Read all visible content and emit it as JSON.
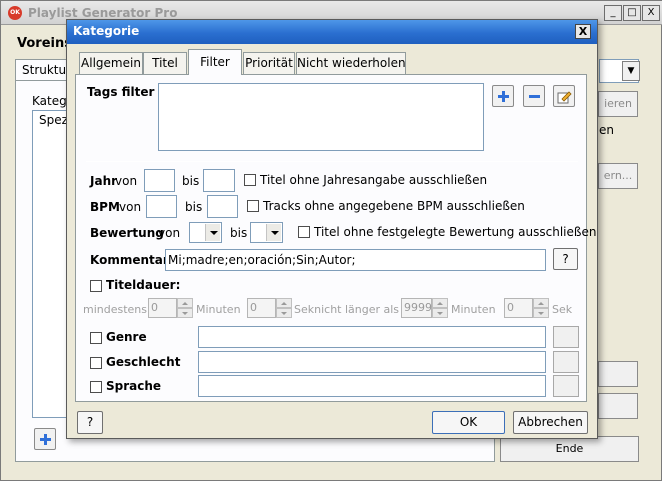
{
  "main_window": {
    "title": "Playlist Generator Pro",
    "app_icon_text": "OK",
    "minimize_glyph": "_",
    "maximize_glyph": "□",
    "close_glyph": "X",
    "voreinst_label": "Voreinst",
    "struktur_tab": "Struktur",
    "kategorie_label": "Katego",
    "list_item": "Spezi",
    "right_btn_1": "ieren",
    "right_label_2": "en",
    "right_btn_3": "ern...",
    "ende_button": "Ende",
    "dropdown_arrow": "▼"
  },
  "dialog": {
    "title": "Kategorie",
    "close_glyph": "X",
    "tabs": [
      {
        "label": "Allgemein"
      },
      {
        "label": "Titel"
      },
      {
        "label": "Filter"
      },
      {
        "label": "Priorität"
      },
      {
        "label": "Nicht wiederholen"
      }
    ],
    "active_tab": "Filter",
    "filter": {
      "tags_label": "Tags filter",
      "tags_value": "",
      "jahr": {
        "label": "Jahr",
        "von": "von",
        "bis": "bis",
        "from_value": "",
        "to_value": "",
        "exclude_label": "Titel ohne Jahresangabe ausschließen"
      },
      "bpm": {
        "label": "BPM",
        "von": "von",
        "bis": "bis",
        "from_value": "",
        "to_value": "",
        "exclude_label": "Tracks ohne angegebene BPM ausschließen"
      },
      "bewertung": {
        "label": "Bewertung",
        "von": "von",
        "bis": "bis",
        "exclude_label": "Titel ohne festgelegte Bewertung ausschließen"
      },
      "kommentar": {
        "label": "Kommentar:",
        "value": "Mi;madre;en;oración;Sin;Autor;",
        "help_button": "?"
      },
      "titeldauer": {
        "label": "Titeldauer:",
        "mindestens": "mindestens",
        "min_value": "0",
        "minuten1": "Minuten",
        "sec_value": "0",
        "sek_nicht": "Seknicht länger als",
        "max_value": "9999",
        "minuten2": "Minuten",
        "max_sec_value": "0",
        "sek": "Sek"
      },
      "genre": {
        "label": "Genre",
        "value": ""
      },
      "geschlecht": {
        "label": "Geschlecht",
        "value": ""
      },
      "sprache": {
        "label": "Sprache",
        "value": ""
      }
    },
    "help_button": "?",
    "ok_button": "OK",
    "cancel_button": "Abbrechen"
  },
  "colors": {
    "dialog_title_bar": "#2a6fd0",
    "add_icon": "#2f6fd8",
    "remove_icon": "#2f6fd8"
  }
}
